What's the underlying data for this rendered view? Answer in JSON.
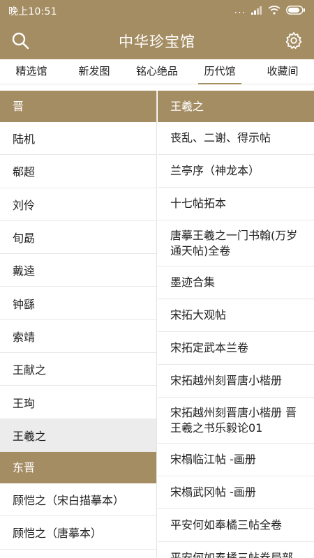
{
  "status": {
    "time": "晚上10:51",
    "dots": "...",
    "signal_icon": "signal-icon",
    "wifi_icon": "wifi-icon",
    "battery_icon": "battery-icon"
  },
  "app": {
    "title": "中华珍宝馆",
    "search_icon": "search-icon",
    "settings_icon": "gear-icon"
  },
  "tabs": [
    {
      "label": "精选馆",
      "active": false
    },
    {
      "label": "新发图",
      "active": false
    },
    {
      "label": "铭心绝品",
      "active": false
    },
    {
      "label": "历代馆",
      "active": true
    },
    {
      "label": "收藏间",
      "active": false
    }
  ],
  "left": {
    "sections": [
      {
        "title": "晋",
        "items": [
          "陆机",
          "郗超",
          "刘伶",
          "旬勗",
          "戴逵",
          "钟繇",
          "索靖",
          "王献之",
          "王珣",
          "王羲之"
        ]
      },
      {
        "title": "东晋",
        "items": [
          "顾恺之（宋白描摹本）",
          "顾恺之（唐摹本）"
        ]
      }
    ],
    "selected": "王羲之"
  },
  "right": {
    "header": "王羲之",
    "items": [
      "丧乱、二谢、得示帖",
      "兰亭序（神龙本）",
      "十七帖拓本",
      "唐摹王羲之一门书翰(万岁通天帖)全卷",
      "墨迹合集",
      "宋拓大观帖",
      "宋拓定武本兰卷",
      "宋拓越州刻晋唐小楷册",
      "宋拓越州刻晋唐小楷册 晋王羲之书乐毅论01",
      "宋榻临江帖 -画册",
      "宋榻武冈帖 -画册",
      "平安何如奉橘三帖全卷",
      "平安何如奉橘三帖卷局部"
    ]
  },
  "colors": {
    "accent": "#a58d63",
    "selected_bg": "#ececec"
  }
}
